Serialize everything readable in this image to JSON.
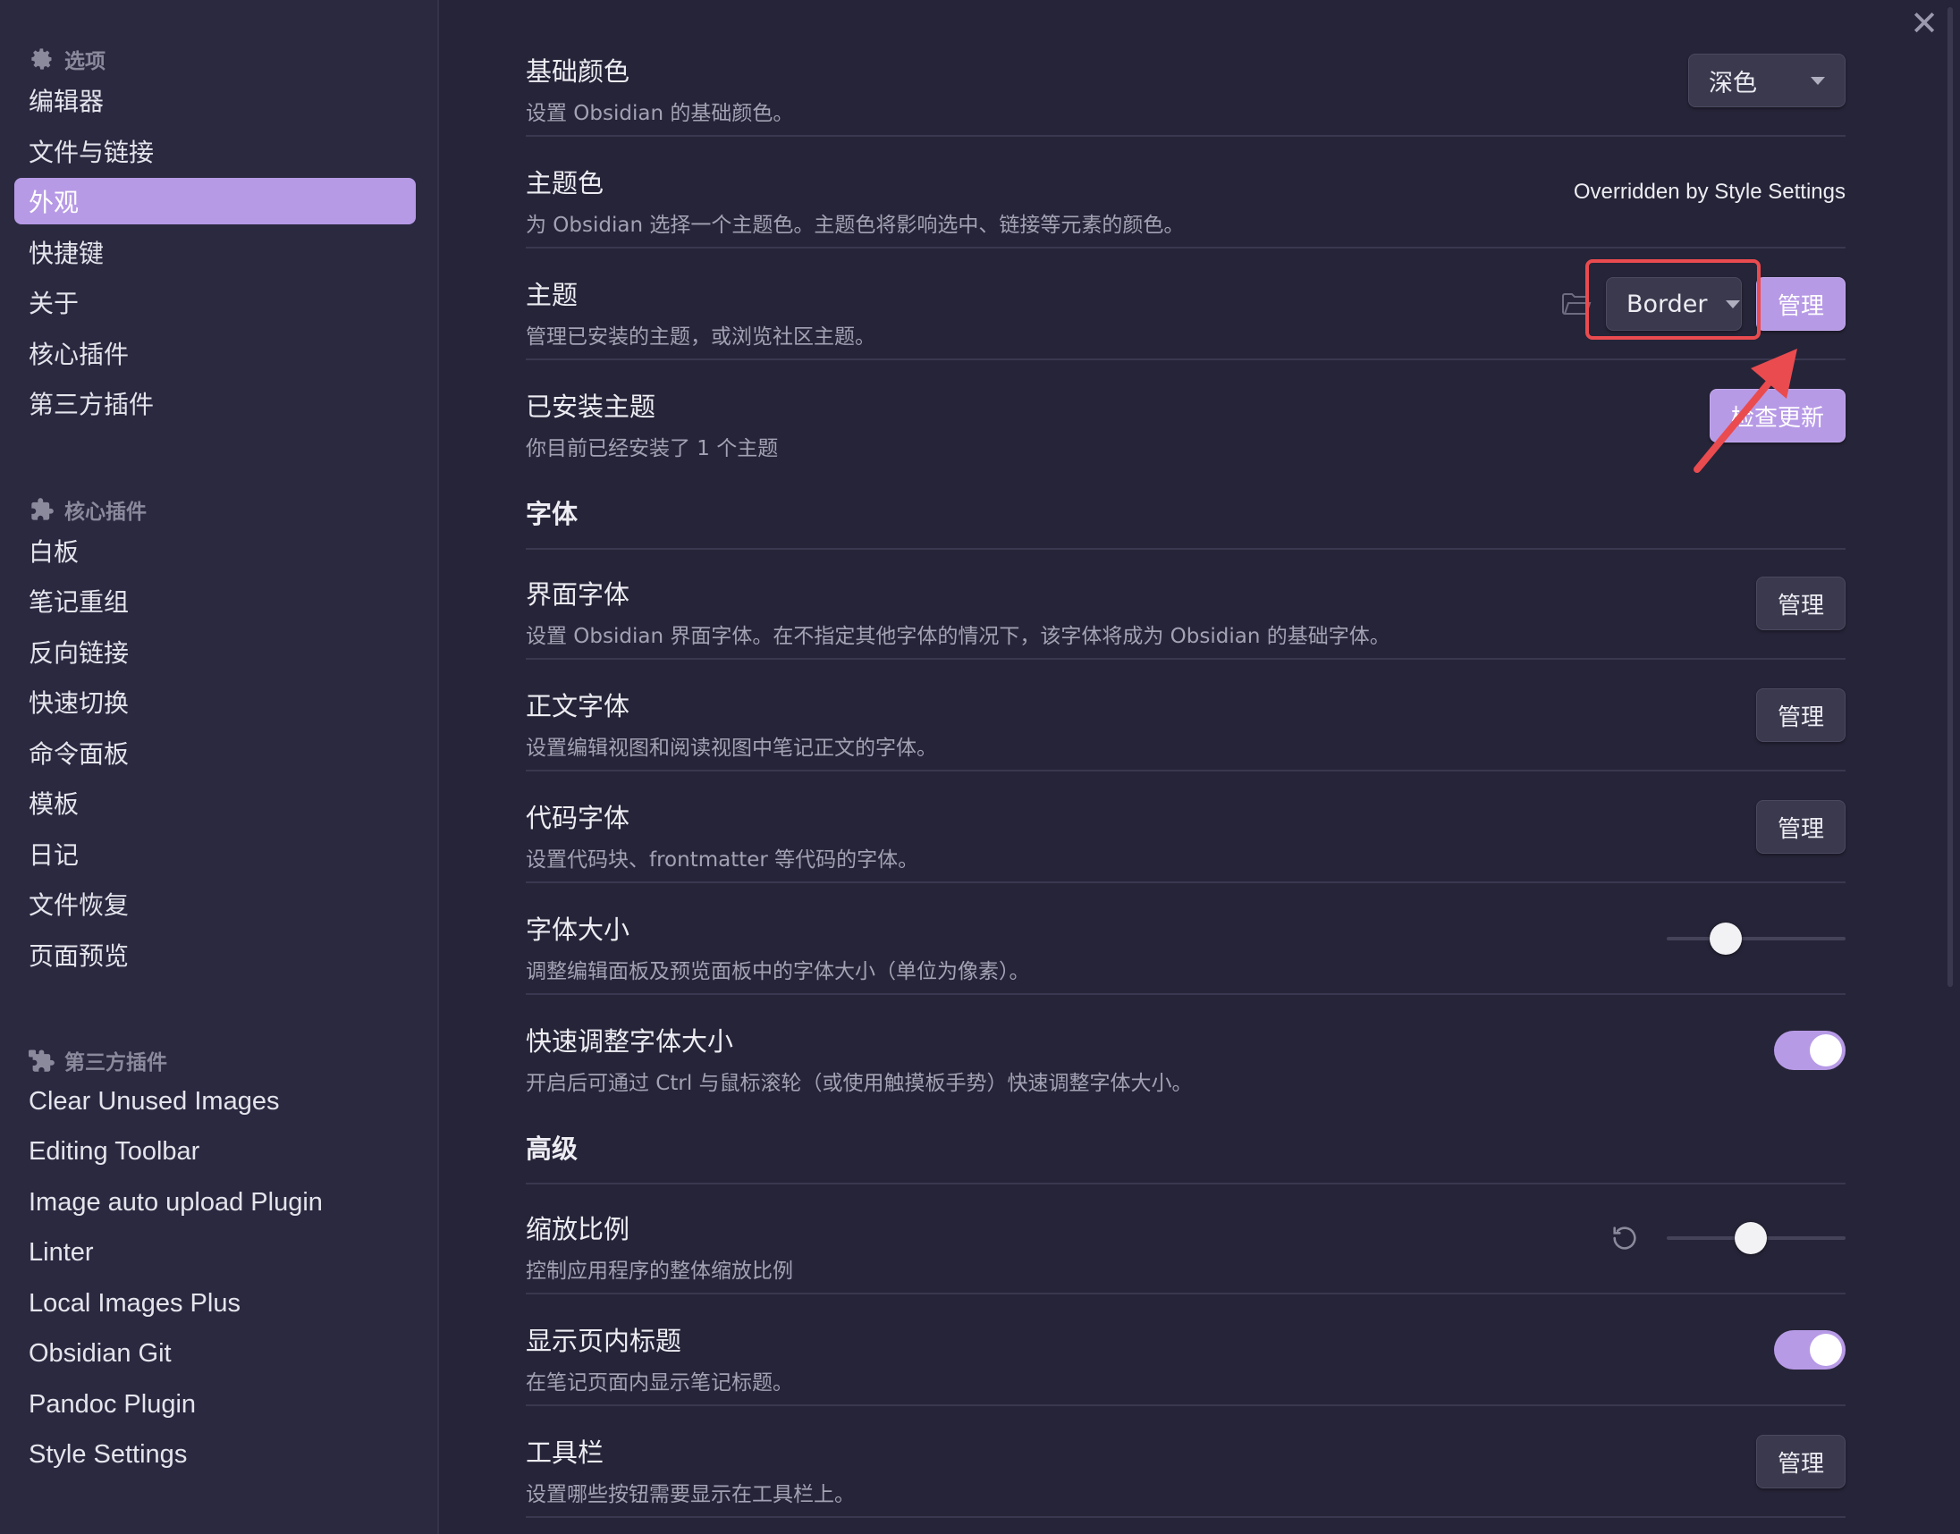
{
  "sidebar": {
    "options_heading": "选项",
    "options": [
      {
        "label": "编辑器"
      },
      {
        "label": "文件与链接"
      },
      {
        "label": "外观",
        "active": true
      },
      {
        "label": "快捷键"
      },
      {
        "label": "关于"
      },
      {
        "label": "核心插件"
      },
      {
        "label": "第三方插件"
      }
    ],
    "core_heading": "核心插件",
    "core_plugins": [
      {
        "label": "白板"
      },
      {
        "label": "笔记重组"
      },
      {
        "label": "反向链接"
      },
      {
        "label": "快速切换"
      },
      {
        "label": "命令面板"
      },
      {
        "label": "模板"
      },
      {
        "label": "日记"
      },
      {
        "label": "文件恢复"
      },
      {
        "label": "页面预览"
      }
    ],
    "community_heading": "第三方插件",
    "community_plugins": [
      {
        "label": "Clear Unused Images"
      },
      {
        "label": "Editing Toolbar"
      },
      {
        "label": "Image auto upload Plugin"
      },
      {
        "label": "Linter"
      },
      {
        "label": "Local Images Plus"
      },
      {
        "label": "Obsidian Git"
      },
      {
        "label": "Pandoc Plugin"
      },
      {
        "label": "Style Settings"
      }
    ]
  },
  "settings": {
    "base_color": {
      "name": "基础颜色",
      "desc": "设置 Obsidian 的基础颜色。",
      "value": "深色"
    },
    "accent_color": {
      "name": "主题色",
      "desc": "为 Obsidian 选择一个主题色。主题色将影响选中、链接等元素的颜色。",
      "value": "Overridden by Style Settings"
    },
    "theme": {
      "name": "主题",
      "desc": "管理已安装的主题，或浏览社区主题。",
      "value": "Border",
      "button": "管理"
    },
    "installed_themes": {
      "name": "已安装主题",
      "desc": "你目前已经安装了 1 个主题",
      "button": "检查更新"
    },
    "font_section": "字体",
    "interface_font": {
      "name": "界面字体",
      "desc": "设置 Obsidian 界面字体。在不指定其他字体的情况下，该字体将成为 Obsidian 的基础字体。",
      "button": "管理"
    },
    "text_font": {
      "name": "正文字体",
      "desc": "设置编辑视图和阅读视图中笔记正文的字体。",
      "button": "管理"
    },
    "code_font": {
      "name": "代码字体",
      "desc": "设置代码块、frontmatter 等代码的字体。",
      "button": "管理"
    },
    "font_size": {
      "name": "字体大小",
      "desc": "调整编辑面板及预览面板中的字体大小（单位为像素）。",
      "level": 0.33
    },
    "quick_font_size": {
      "name": "快速调整字体大小",
      "desc": "开启后可通过 Ctrl 与鼠标滚轮（或使用触摸板手势）快速调整字体大小。",
      "on": true
    },
    "advanced_section": "高级",
    "zoom": {
      "name": "缩放比例",
      "desc": "控制应用程序的整体缩放比例",
      "level": 0.47
    },
    "show_inline_title": {
      "name": "显示页内标题",
      "desc": "在笔记页面内显示笔记标题。",
      "on": true
    },
    "toolbar": {
      "name": "工具栏",
      "desc": "设置哪些按钮需要显示在工具栏上。",
      "button": "管理"
    }
  },
  "icons": {
    "close": "close-icon",
    "options": "gear-icon",
    "core": "puzzle-icon",
    "community": "puzzles-icon",
    "folder": "folder-icon",
    "reset": "reset-icon"
  },
  "colors": {
    "accent": "#b79ae6",
    "annotation": "#ea4b4f",
    "background": "#262438"
  }
}
